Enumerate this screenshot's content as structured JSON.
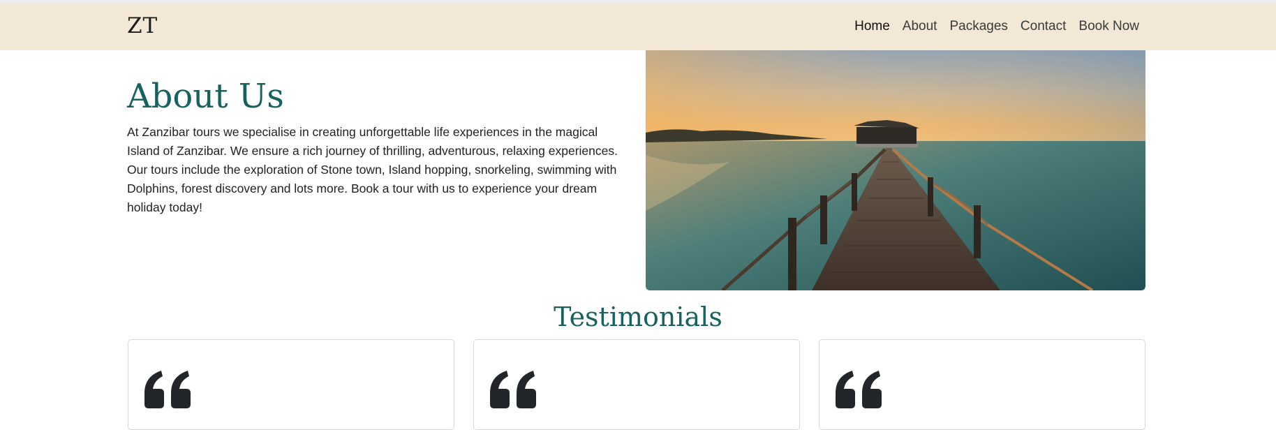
{
  "navbar": {
    "brand": "ZT",
    "links": [
      {
        "label": "Home",
        "active": true
      },
      {
        "label": "About",
        "active": false
      },
      {
        "label": "Packages",
        "active": false
      },
      {
        "label": "Contact",
        "active": false
      },
      {
        "label": "Book Now",
        "active": false
      }
    ]
  },
  "about": {
    "title": "About Us",
    "text": "At Zanzibar tours we specialise in creating unforgettable life experiences in the magical Island of Zanzibar. We ensure a rich journey of thrilling, adventurous, relaxing experiences. Our tours include the exploration of Stone town, Island hopping, snorkeling, swimming with Dolphins, forest discovery and lots more. Book a tour with us to experience your dream holiday today!",
    "image_icon": "pier-sunset-photo"
  },
  "testimonials": {
    "title": "Testimonials",
    "cards": [
      {
        "icon": "quote-icon"
      },
      {
        "icon": "quote-icon"
      },
      {
        "icon": "quote-icon"
      }
    ]
  },
  "colors": {
    "navbar_bg": "#f2e8d5",
    "accent_teal": "#17625f",
    "text": "#222222",
    "quote_icon": "#22262b"
  }
}
